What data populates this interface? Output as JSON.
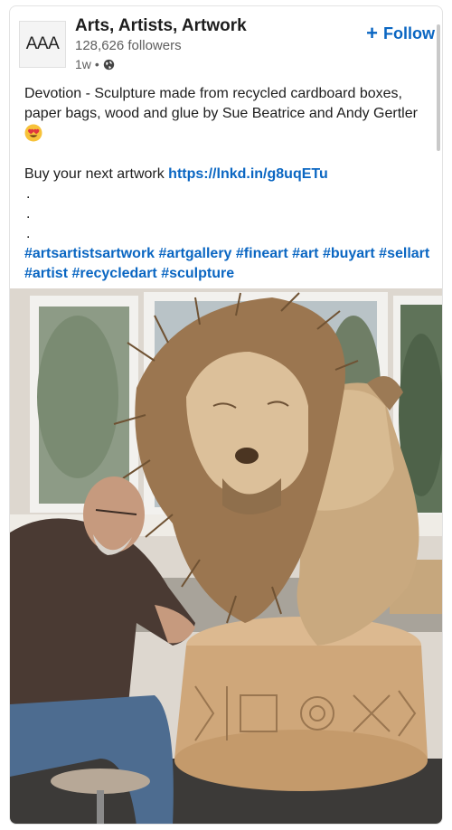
{
  "post": {
    "author": {
      "logo_text": "AAA",
      "name": "Arts, Artists, Artwork",
      "followers": "128,626 followers",
      "time": "1w",
      "separator": "•"
    },
    "follow_button": {
      "icon": "+",
      "label": "Follow"
    },
    "text": {
      "line1": "Devotion - Sculpture made from recycled cardboard boxes, paper bags, wood and glue by Sue Beatrice and Andy Gertler",
      "emoji": "heart-eyes-emoji",
      "buy_prefix": "Buy your next artwork ",
      "buy_link": "https://lnkd.in/g8uqETu",
      "dots": [
        ".",
        ".",
        "."
      ],
      "hashtags": "#artsartistsartwork #artgallery #fineart #art #buyart #sellart #artist #recycledart #sculpture"
    },
    "image": {
      "subject": "cardboard-lion-sculpture-photo"
    }
  },
  "colors": {
    "link": "#0a66c2",
    "text": "#1d1d1d",
    "muted": "#5e5e5e"
  }
}
